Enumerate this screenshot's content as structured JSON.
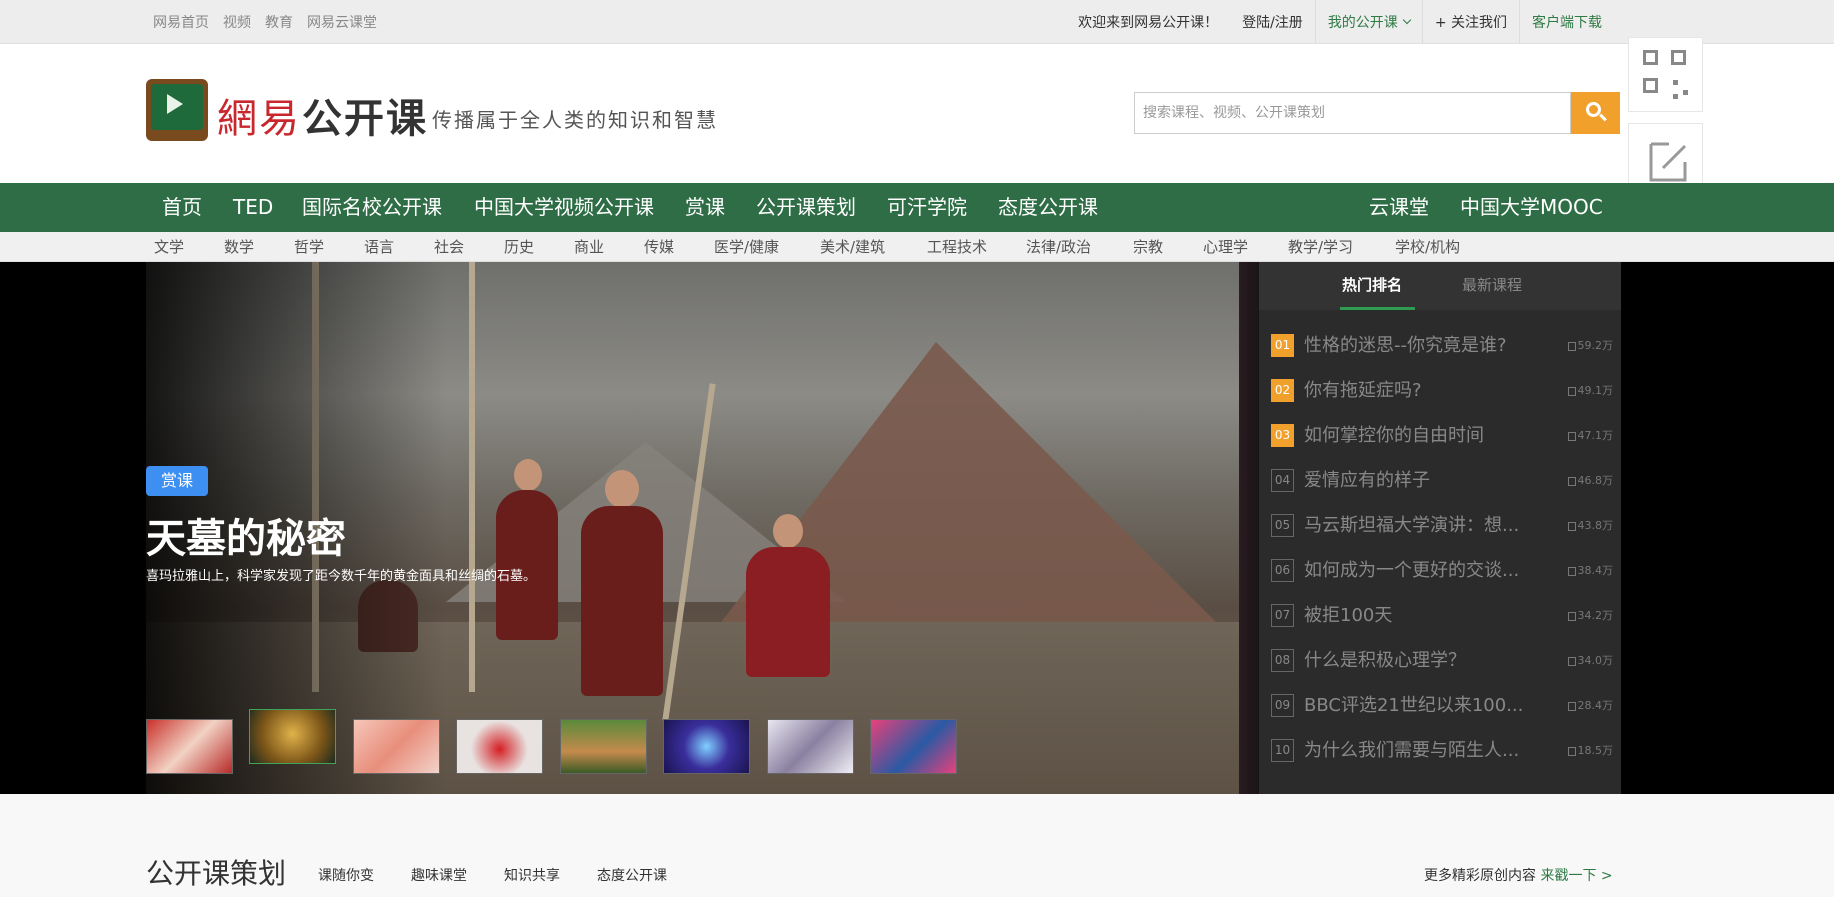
{
  "topbar": {
    "left_links": [
      "网易首页",
      "视频",
      "教育",
      "网易云课堂"
    ],
    "welcome": "欢迎来到网易公开课！",
    "login": "登陆/注册",
    "my_course": "我的公开课",
    "follow": "+ 关注我们",
    "client_download": "客户端下载"
  },
  "header": {
    "logo_text_a": "網易",
    "logo_text_b": "公开课",
    "slogan": "传播属于全人类的知识和智慧",
    "search_placeholder": "搜索课程、视频、公开课策划"
  },
  "nav": {
    "items": [
      "首页",
      "TED",
      "国际名校公开课",
      "中国大学视频公开课",
      "赏课",
      "公开课策划",
      "可汗学院",
      "态度公开课"
    ],
    "right_items": [
      "云课堂",
      "中国大学MOOC"
    ]
  },
  "subnav": {
    "items": [
      "文学",
      "数学",
      "哲学",
      "语言",
      "社会",
      "历史",
      "商业",
      "传媒",
      "医学/健康",
      "美术/建筑",
      "工程技术",
      "法律/政治",
      "宗教",
      "心理学",
      "教学/学习",
      "学校/机构"
    ]
  },
  "banner": {
    "tag": "赏课",
    "title": "天墓的秘密",
    "description": "喜玛拉雅山上，科学家发现了距今数千年的黄金面具和丝绸的石墓。"
  },
  "ranking": {
    "tabs": [
      "热门排名",
      "最新课程"
    ],
    "items": [
      {
        "num": "01",
        "title": "性格的迷思--你究竟是谁?",
        "count": "59.2万"
      },
      {
        "num": "02",
        "title": "你有拖延症吗?",
        "count": "49.1万"
      },
      {
        "num": "03",
        "title": "如何掌控你的自由时间",
        "count": "47.1万"
      },
      {
        "num": "04",
        "title": "爱情应有的样子",
        "count": "46.8万"
      },
      {
        "num": "05",
        "title": "马云斯坦福大学演讲：想...",
        "count": "43.8万"
      },
      {
        "num": "06",
        "title": "如何成为一个更好的交谈...",
        "count": "38.4万"
      },
      {
        "num": "07",
        "title": "被拒100天",
        "count": "34.2万"
      },
      {
        "num": "08",
        "title": "什么是积极心理学？",
        "count": "34.0万"
      },
      {
        "num": "09",
        "title": "BBC评选21世纪以来100...",
        "count": "28.4万"
      },
      {
        "num": "10",
        "title": "为什么我们需要与陌生人...",
        "count": "18.5万"
      }
    ]
  },
  "section": {
    "title": "公开课策划",
    "links": [
      "课随你变",
      "趣味课堂",
      "知识共享",
      "态度公开课"
    ],
    "more_text": "更多精彩原创内容",
    "more_link": "来戳一下 >"
  },
  "colors": {
    "brand_green": "#2e6d46",
    "accent_orange": "#f1a02c",
    "tag_blue": "#3e8ff2"
  }
}
